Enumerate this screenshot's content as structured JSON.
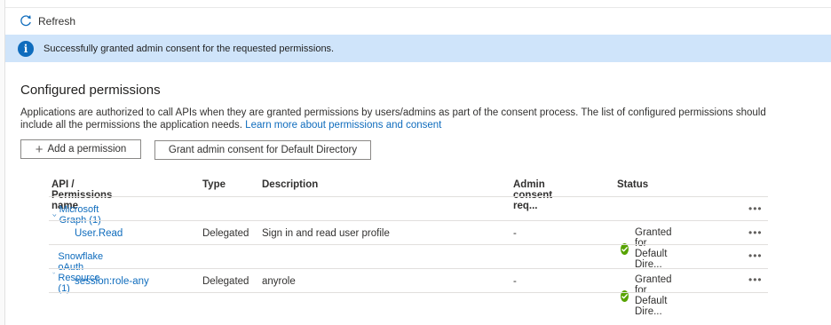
{
  "toolbar": {
    "refresh_label": "Refresh"
  },
  "banner": {
    "message": "Successfully granted admin consent for the requested permissions."
  },
  "section": {
    "title": "Configured permissions",
    "description": "Applications are authorized to call APIs when they are granted permissions by users/admins as part of the consent process. The list of configured permissions should include all the permissions the application needs.",
    "learn_more_link": "Learn more about permissions and consent"
  },
  "buttons": {
    "add_permission": "Add a permission",
    "grant_consent": "Grant admin consent for Default Directory"
  },
  "table": {
    "headers": {
      "api": "API / Permissions name",
      "type": "Type",
      "description": "Description",
      "admin_consent": "Admin consent req...",
      "status": "Status"
    },
    "groups": [
      {
        "name": "Microsoft Graph (1)",
        "permission": {
          "name": "User.Read",
          "type": "Delegated",
          "description": "Sign in and read user profile",
          "admin_consent": "-",
          "status": "Granted for Default Dire..."
        }
      },
      {
        "name": "Snowflake oAuth Resource (1)",
        "permission": {
          "name": "session:role-any",
          "type": "Delegated",
          "description": "anyrole",
          "admin_consent": "-",
          "status": "Granted for Default Dire..."
        }
      }
    ],
    "more_label": "•••"
  },
  "colors": {
    "accent": "#0f6cbd",
    "banner_bg": "#cfe4fa",
    "status_granted": "#57a300"
  }
}
